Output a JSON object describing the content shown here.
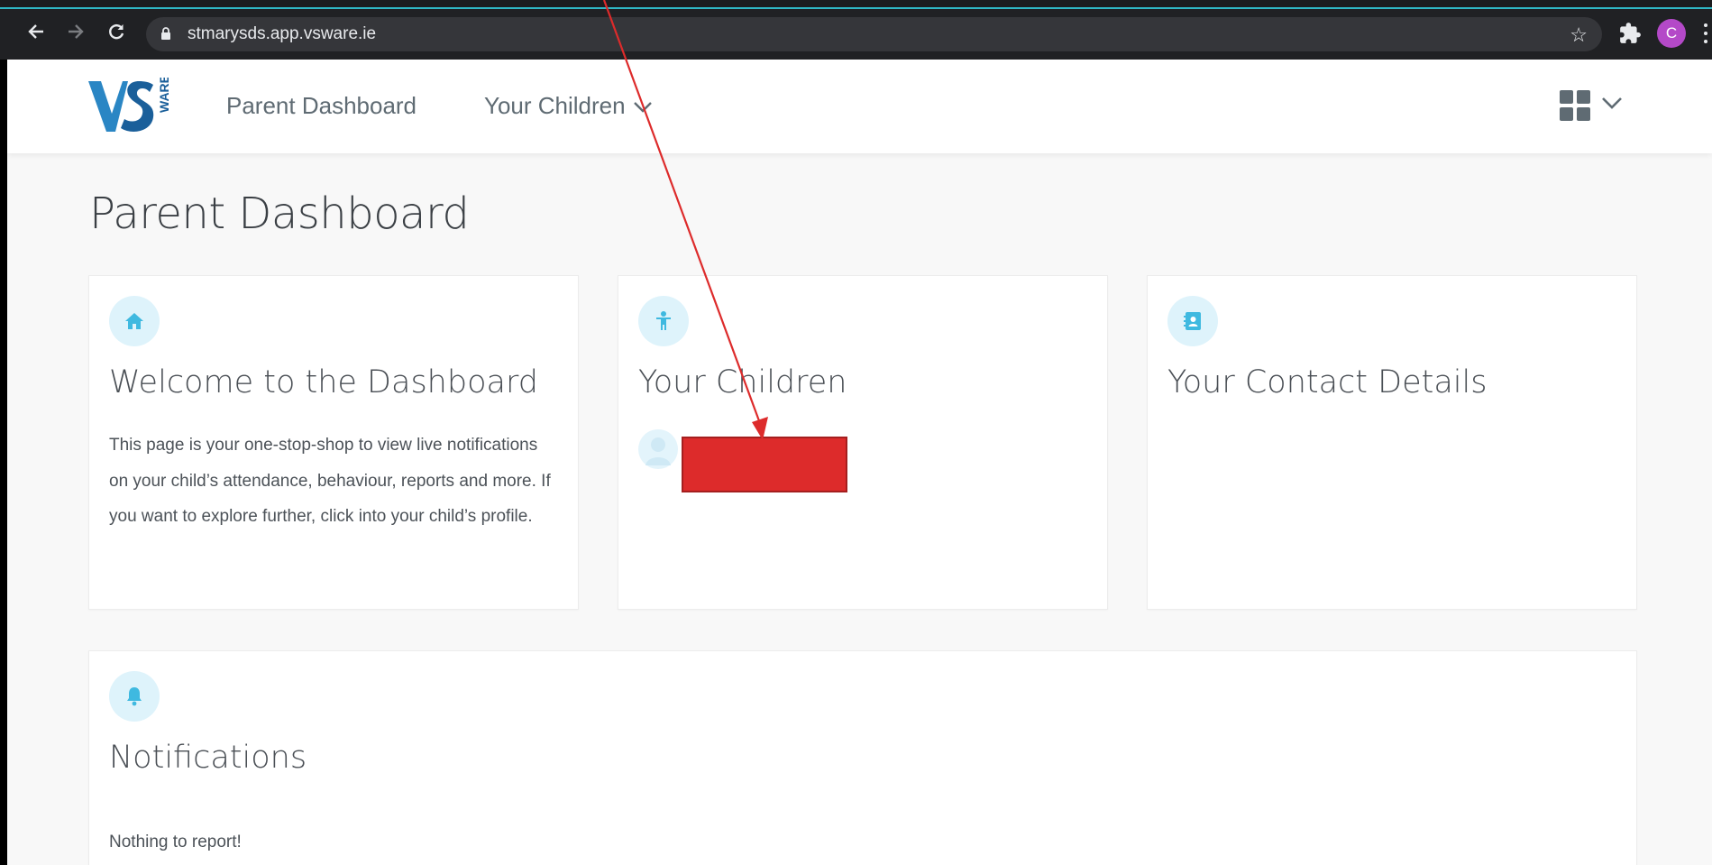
{
  "browser": {
    "url": "stmarysds.app.vsware.ie",
    "profile_initial": "C",
    "back_icon": "arrow-left-icon",
    "forward_icon": "arrow-right-icon",
    "reload_icon": "reload-icon",
    "bookmark_icon": "star-icon",
    "extensions_icon": "puzzle-icon",
    "accent_color": "#2fb6c4"
  },
  "app": {
    "logo_text": "VSWARE",
    "nav": {
      "dashboard": "Parent Dashboard",
      "children": "Your Children"
    },
    "apps_icon": "grid-icon"
  },
  "page": {
    "title": "Parent Dashboard",
    "cards": {
      "welcome": {
        "title": "Welcome to the Dashboard",
        "body": "This page is your one-stop-shop to view live notifications on your child’s attendance, behaviour, reports and more. If you want to explore further, click into your child’s profile.",
        "icon": "home-icon"
      },
      "children": {
        "title": "Your Children",
        "icon": "child-icon"
      },
      "contact": {
        "title": "Your Contact Details",
        "icon": "contact-book-icon"
      },
      "notifications": {
        "title": "Notifications",
        "empty": "Nothing to report!",
        "icon": "bell-icon"
      }
    }
  },
  "annotation": {
    "color": "#dd2b2b"
  }
}
